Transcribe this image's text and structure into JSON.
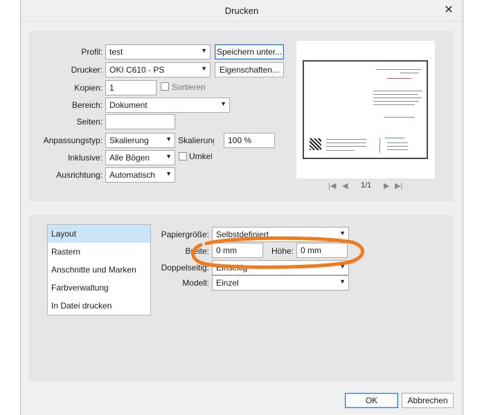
{
  "window": {
    "title": "Drucken"
  },
  "print": {
    "profile_label": "Profil:",
    "profile_value": "test",
    "save_as_label": "Speichern unter...",
    "printer_label": "Drucker:",
    "printer_value": "OKI C610 - PS",
    "properties_label": "Eigenschaften...",
    "copies_label": "Kopien:",
    "copies_value": "1",
    "collate_label": "Sortieren",
    "range_label": "Bereich:",
    "range_value": "Dokument",
    "pages_label": "Seiten:",
    "pages_value": "",
    "fit_label": "Anpassungstyp:",
    "fit_value": "Skalierung",
    "scale_label": "Skalierung",
    "scale_value": "100 %",
    "include_label": "Inklusive:",
    "include_value": "Alle Bögen",
    "reverse_label": "Umkeh",
    "orientation_label": "Ausrichtung:",
    "orientation_value": "Automatisch"
  },
  "preview": {
    "page_indicator": "1/1"
  },
  "sidebar": {
    "items": [
      {
        "label": "Layout"
      },
      {
        "label": "Rastern"
      },
      {
        "label": "Anschnitte und Marken"
      },
      {
        "label": "Farbverwaltung"
      },
      {
        "label": "In Datei drucken"
      }
    ]
  },
  "layout": {
    "paper_size_label": "Papiergröße:",
    "paper_size_value": "Selbstdefiniert",
    "width_label": "Breite:",
    "width_value": "0 mm",
    "height_label": "Höhe:",
    "height_value": "0 mm",
    "duplex_label": "Doppelseitig:",
    "duplex_value": "Einseitig",
    "model_label": "Modell:",
    "model_value": "Einzel"
  },
  "footer": {
    "ok_label": "OK",
    "cancel_label": "Abbrechen"
  },
  "annotation": {
    "color": "#f07a1e"
  }
}
